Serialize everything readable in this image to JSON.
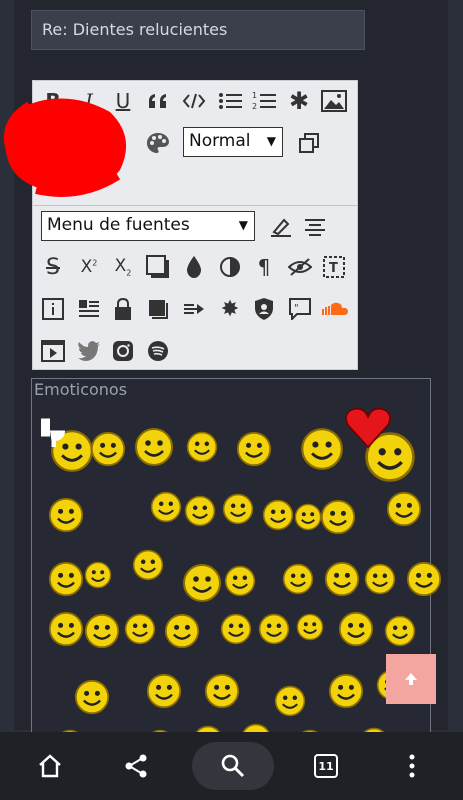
{
  "subject": {
    "value": "Re: Dientes relucientes"
  },
  "editor": {
    "size_select": {
      "selected": "Normal"
    },
    "font_select": {
      "selected": "Menu de fuentes"
    },
    "italic_label": "I",
    "underline_label": "U",
    "superscript_label": "X",
    "subscript_label": "X"
  },
  "emoticons": {
    "title": "Emoticonos"
  },
  "bottom_nav": {
    "tab_count": "11"
  },
  "colors": {
    "editor_bg": "#e9ebee",
    "page_bg": "#2b2f3a",
    "scroll_top_bg": "#f3a6a0",
    "annotation_red": "#ff0000"
  }
}
